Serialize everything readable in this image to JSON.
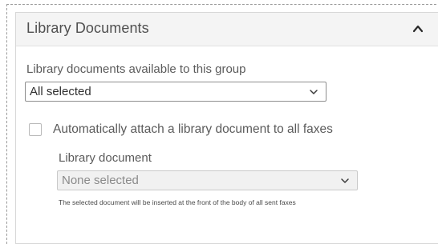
{
  "panel": {
    "title": "Library Documents",
    "collapse_icon": "chevron-up-icon"
  },
  "group_docs": {
    "label": "Library documents available to this group",
    "selected": "All selected"
  },
  "auto_attach": {
    "checked": false,
    "label": "Automatically attach a library document to all faxes"
  },
  "library_document": {
    "label": "Library document",
    "selected": "None selected",
    "disabled": true,
    "note": "The selected document will be inserted at the front of the body of all sent faxes"
  }
}
